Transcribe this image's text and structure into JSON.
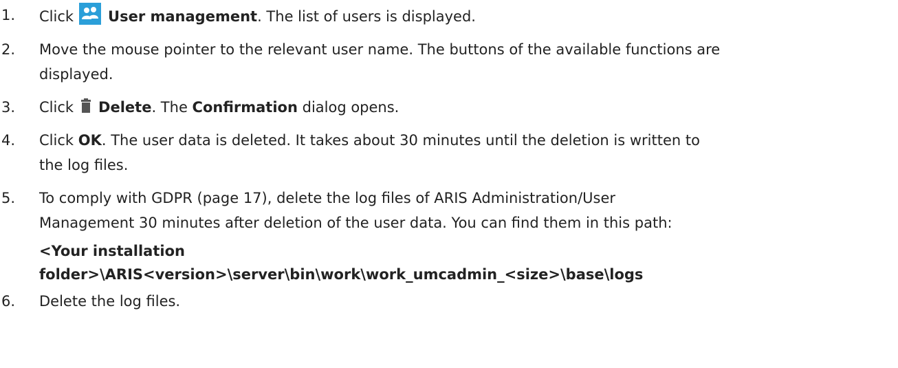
{
  "steps": [
    {
      "num": "1.",
      "pre": "Click",
      "icon": "users-group-icon",
      "bold": "User management",
      "post": ". The list of users is displayed."
    },
    {
      "num": "2.",
      "text_line1": "Move the mouse pointer to the relevant user name. The buttons of the available functions are",
      "text_line2": "displayed."
    },
    {
      "num": "3.",
      "pre": "Click",
      "icon": "trash-icon",
      "bold": "Delete",
      "mid": ". The ",
      "bold2": "Confirmation",
      "post": " dialog opens."
    },
    {
      "num": "4.",
      "pre": "Click ",
      "bold": "OK",
      "post_line1": ". The user data is deleted. It takes about 30 minutes until the deletion is written to",
      "post_line2": "the log files."
    },
    {
      "num": "5.",
      "text_line1": "To comply with GDPR (page 17), delete the log files of ARIS Administration/User",
      "text_line2": "Management 30 minutes after deletion of the user data. You can find them in this path:",
      "path_line1": "<Your installation",
      "path_line2": "folder>\\ARIS<version>\\server\\bin\\work\\work_umcadmin_<size>\\base\\logs"
    },
    {
      "num": "6.",
      "text": "Delete the log files."
    }
  ],
  "colors": {
    "text": "#222222",
    "icon_blue": "#2b9fd9",
    "trash": "#555555"
  }
}
